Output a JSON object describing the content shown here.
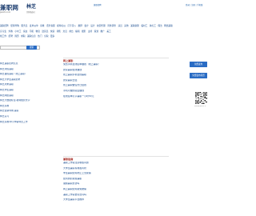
{
  "header": {
    "logo": "兼职网",
    "logo_sub": "jianzhi.com",
    "city": "林芝",
    "city_switch": "[切换城市]",
    "center_link": "兼职招聘",
    "right_links": "登录 | 注册 | 手机版"
  },
  "categories": {
    "row1": [
      "兼职招聘",
      "促销导购",
      "服务员",
      "发单派单",
      "家教",
      "话务客服",
      "模特礼仪",
      "打字录入",
      "翻译",
      "会计",
      "设计",
      "校园代理",
      "问卷调查",
      "演员",
      "其他",
      "兼职助理",
      "临时工",
      "钟点工",
      "保洁",
      "网络兼职"
    ],
    "row2": [
      "实习生",
      "外教",
      "小时工",
      "家政",
      "司机",
      "物流",
      "送货员",
      "快递",
      "销售",
      "文员",
      "前台",
      "编辑",
      "摄影",
      "主持",
      "策划",
      "推广",
      "美工"
    ],
    "row3": [
      "找工作",
      "招聘",
      "简历",
      "求职",
      "兼职信息",
      "热门",
      "全职",
      "更多"
    ]
  },
  "search": {
    "placeholder": "",
    "button_label": "搜索"
  },
  "left_list": [
    "林芝兼职招聘信息",
    "林芝寒假兼职",
    "林芝暑假兼职（线上兼职）",
    "林芝大学生兼职招聘",
    "林芝周末兼职",
    "林芝学生兼职",
    "林芝网络兼职",
    "林芝大数据标注-模特摄影文字",
    "林芝家教",
    "林芝促销导购 兼职",
    "林芝实习",
    "林芝家教/中小学辅导员工作"
  ],
  "panel_1": {
    "title": "网上兼职",
    "items": [
      "免费手机在线接单赚钱（线上兼职）",
      "居家兼职在线赚钱",
      "线上兼职手机在线兼职",
      "居家兼职日结",
      "线上兼职做任务日结钱",
      "手机可做的副业赚钱",
      "在线接单打字兼职一小时30元"
    ]
  },
  "panel_2": {
    "title": "兼职指南",
    "items": [
      "兼职工作需注意哪些问题",
      "大学生兼职有哪些风险",
      "学生兼职如何防止上当受骗",
      "如何辨别真假兼职",
      "暑假兼职靠谱吗",
      "网上兼职如何避免被骗",
      "兼职工作需要签合同吗",
      "大学生兼职平台推荐"
    ]
  },
  "sidebar": {
    "post_job": "免费发布",
    "post_resume": "免费发布简历",
    "qr_caption": "扫码关注公众号"
  }
}
